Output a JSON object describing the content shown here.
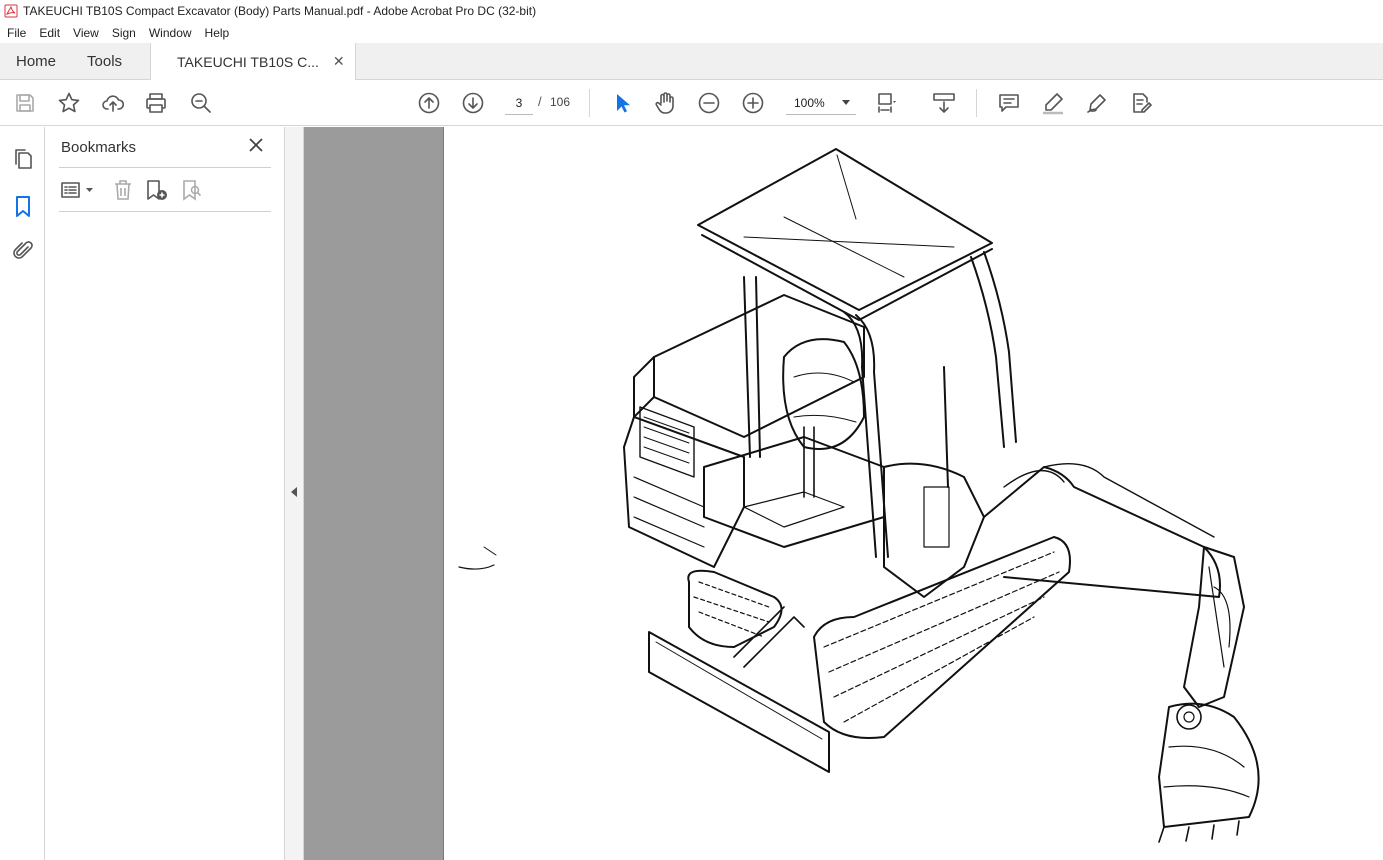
{
  "window": {
    "title": "TAKEUCHI TB10S Compact Excavator (Body) Parts Manual.pdf - Adobe Acrobat Pro DC (32-bit)",
    "app_icon": "acrobat-icon",
    "accent_color": "#d7373f"
  },
  "menu": {
    "items": [
      "File",
      "Edit",
      "View",
      "Sign",
      "Window",
      "Help"
    ]
  },
  "tabs": {
    "home": "Home",
    "tools": "Tools",
    "document": "TAKEUCHI TB10S C...",
    "close_glyph": "✕"
  },
  "toolbar": {
    "current_page": "3",
    "page_separator": "/",
    "total_pages": "106",
    "zoom": "100%",
    "icons": [
      "save-icon",
      "bookmark-star-icon",
      "upload-cloud-icon",
      "print-icon",
      "search-zoom-icon",
      "page-up-icon",
      "page-down-icon",
      "select-pointer-icon",
      "hand-icon",
      "zoom-out-icon",
      "zoom-in-icon",
      "page-fit-icon",
      "scroll-mode-icon",
      "comment-icon",
      "highlight-pen-icon",
      "sign-icon",
      "edit-pdf-icon"
    ],
    "accent_color": "#1473e6"
  },
  "bookmarks": {
    "title": "Bookmarks",
    "close_glyph": "✕"
  }
}
